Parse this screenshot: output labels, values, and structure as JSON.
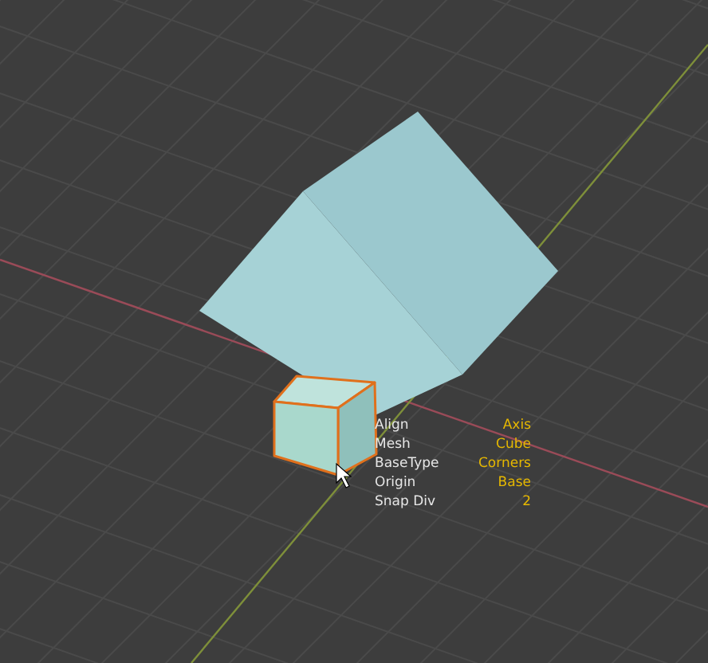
{
  "viewport": {
    "overlay": [
      {
        "label": "Align",
        "value": "Axis"
      },
      {
        "label": "Mesh",
        "value": "Cube"
      },
      {
        "label": "BaseType",
        "value": "Corners"
      },
      {
        "label": "Origin",
        "value": "Base"
      },
      {
        "label": "Snap Div",
        "value": "2"
      }
    ]
  }
}
